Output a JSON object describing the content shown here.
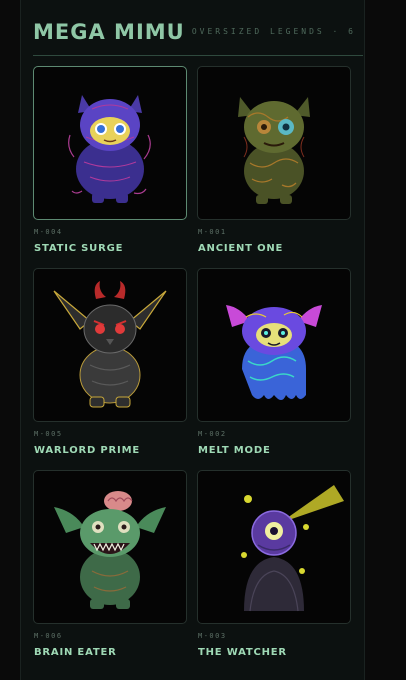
{
  "header": {
    "title": "MEGA MIMU",
    "subtitle": "OVERSIZED LEGENDS · 6"
  },
  "cards": [
    {
      "code": "M-004",
      "name": "STATIC SURGE",
      "icon": "static-surge-creature-icon",
      "selected": true
    },
    {
      "code": "M-001",
      "name": "ANCIENT ONE",
      "icon": "ancient-one-creature-icon",
      "selected": false
    },
    {
      "code": "M-005",
      "name": "WARLORD PRIME",
      "icon": "warlord-prime-creature-icon",
      "selected": false
    },
    {
      "code": "M-002",
      "name": "MELT MODE",
      "icon": "melt-mode-creature-icon",
      "selected": false
    },
    {
      "code": "M-006",
      "name": "BRAIN EATER",
      "icon": "brain-eater-creature-icon",
      "selected": false
    },
    {
      "code": "M-003",
      "name": "THE WATCHER",
      "icon": "the-watcher-creature-icon",
      "selected": false
    }
  ],
  "colors": {
    "background": "#0c1110",
    "title": "#8fc7a6",
    "name": "#9fd9b5",
    "code": "#5c6f65",
    "divider": "#2f4a3e",
    "card_border": "#25302c",
    "selected_border": "#5d8a72"
  }
}
